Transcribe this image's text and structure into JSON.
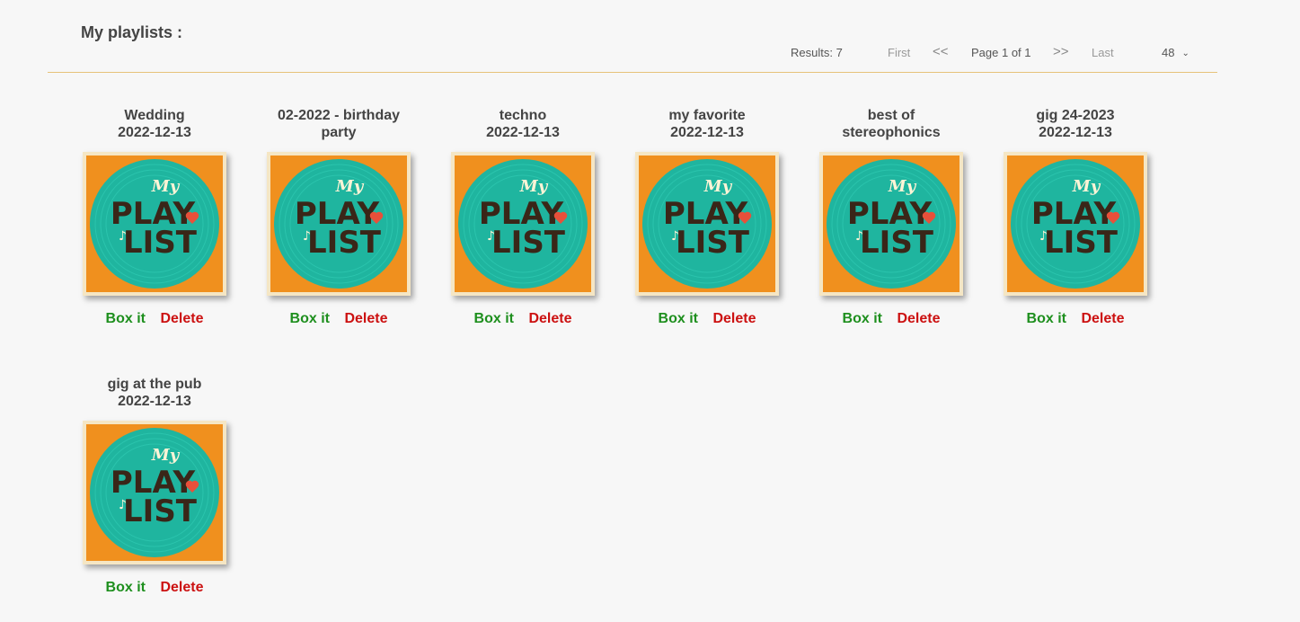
{
  "header": {
    "title": "My playlists :"
  },
  "pagination": {
    "results": "Results: 7",
    "first": "First",
    "prev": "<<",
    "page_info": "Page 1 of 1",
    "next": ">>",
    "last": "Last",
    "per_page": "48"
  },
  "cover_art": {
    "line1": "My",
    "line2": "PLAY",
    "line3": "LIST"
  },
  "actions": {
    "box_it": "Box it",
    "delete": "Delete"
  },
  "playlists": [
    {
      "title_line1": "Wedding",
      "title_line2": "2022-12-13"
    },
    {
      "title_line1": "02-2022 - birthday",
      "title_line2": "party"
    },
    {
      "title_line1": "techno",
      "title_line2": "2022-12-13"
    },
    {
      "title_line1": "my favorite",
      "title_line2": "2022-12-13"
    },
    {
      "title_line1": "best of",
      "title_line2": "stereophonics"
    },
    {
      "title_line1": "gig 24-2023",
      "title_line2": "2022-12-13"
    },
    {
      "title_line1": "gig at the pub",
      "title_line2": "2022-12-13"
    }
  ],
  "colors": {
    "background": "#f7f7f7",
    "divider": "#e7c27a",
    "box_it": "#1e8f1e",
    "delete": "#cc1111",
    "cover_orange": "#f0901e",
    "cover_teal": "#1fb59f"
  }
}
